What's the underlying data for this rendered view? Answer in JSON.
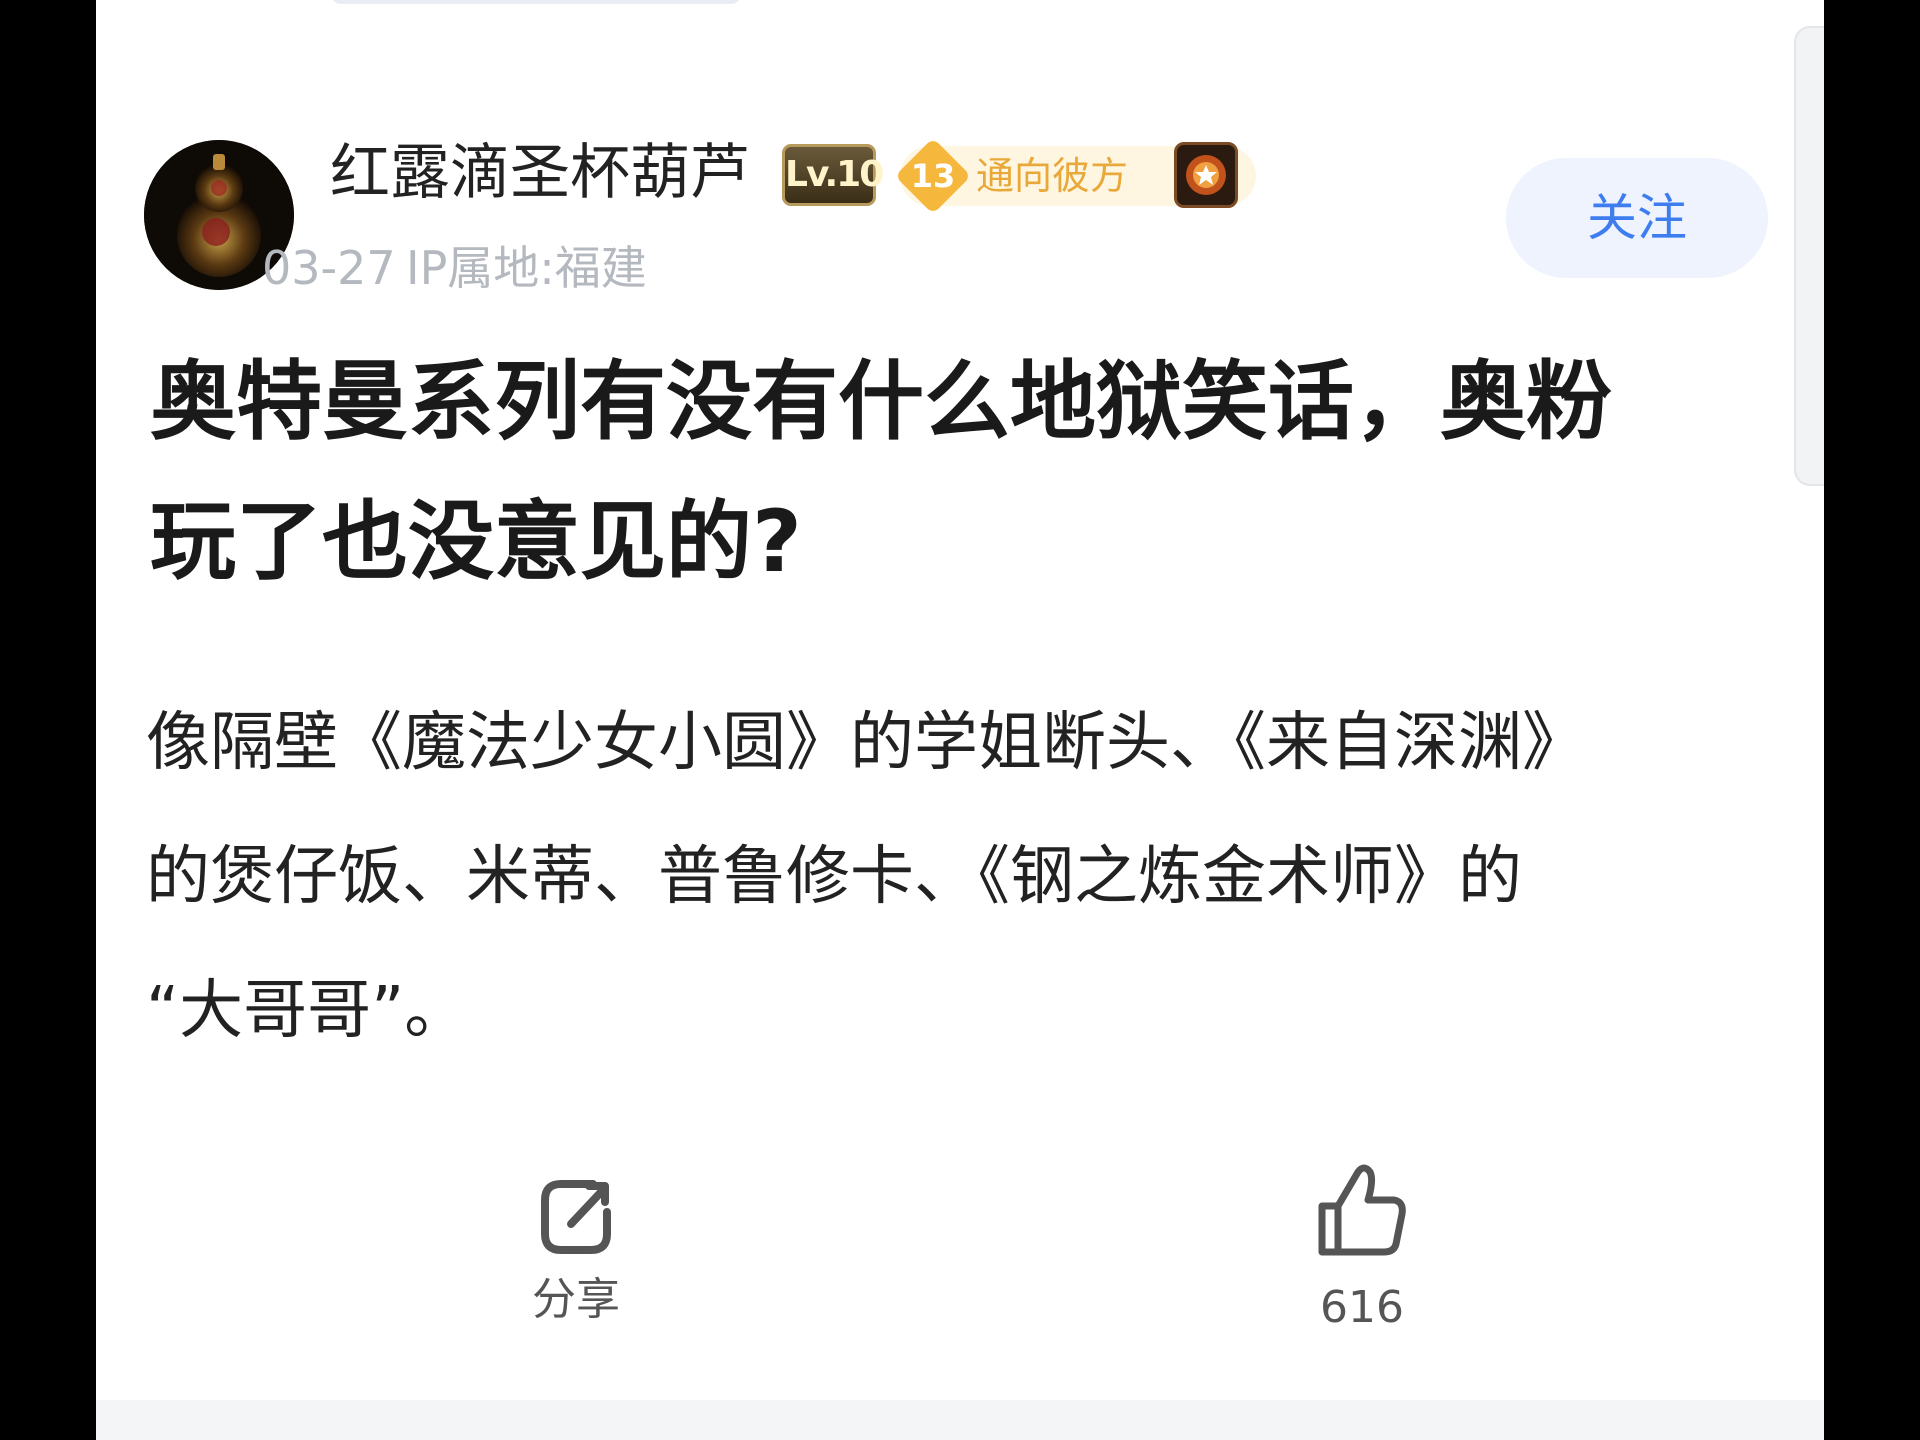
{
  "author": {
    "name": "红露滴圣杯葫芦",
    "level": "Lv.10",
    "fan_level": "13",
    "fan_badge": "通向彼方",
    "date": "03-27",
    "ip_location": "IP属地:福建"
  },
  "follow_label": "关注",
  "post": {
    "title_line1": "奥特曼系列有没有什么地狱笑话，奥粉",
    "title_line2": "玩了也没意见的?",
    "body_line1": "像隔壁《魔法少女小圆》的学姐断头、《来自深渊》",
    "body_line2": "的煲仔饭、米蒂、普鲁修卡、《钢之炼金术师》的",
    "body_line3": "“大哥哥”。"
  },
  "actions": {
    "share_label": "分享",
    "like_count": "616"
  }
}
